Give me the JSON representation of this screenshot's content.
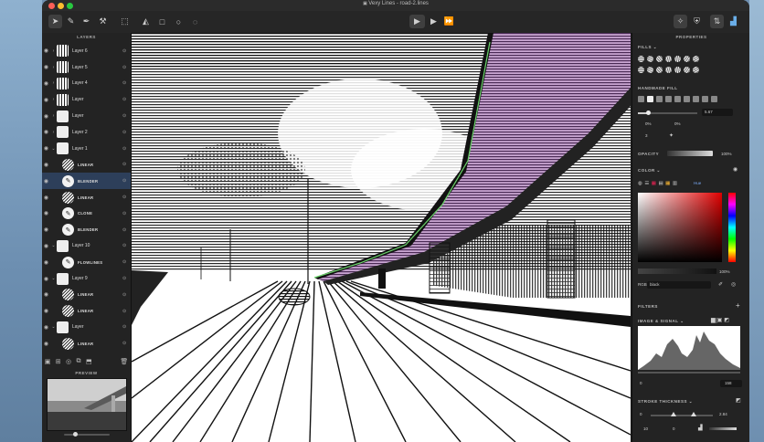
{
  "window": {
    "title": "Vexy Lines - road-2.lines",
    "title_icon": "document-icon"
  },
  "toolbar": {
    "left_tools": [
      "pointer-icon",
      "pen-icon",
      "bezier-pen-icon",
      "brush-icon",
      "transform-icon",
      "fill-bucket-icon",
      "rectangle-icon",
      "ellipse-icon",
      "lasso-icon"
    ],
    "center": [
      "run-icon",
      "play-icon",
      "fast-forward-icon"
    ],
    "right_tools": [
      "magic-wand-icon",
      "shield-icon",
      "properties-icon",
      "chart-icon"
    ]
  },
  "layers_panel": {
    "header": "LAYERS",
    "items": [
      {
        "name": "Layer 6",
        "type": "group",
        "thumb": "img",
        "expanded": false
      },
      {
        "name": "Layer 5",
        "type": "group",
        "thumb": "img",
        "expanded": false
      },
      {
        "name": "Layer 4",
        "type": "group",
        "thumb": "img",
        "expanded": false
      },
      {
        "name": "Layer",
        "type": "group",
        "thumb": "img",
        "expanded": false
      },
      {
        "name": "Layer",
        "type": "group",
        "thumb": "plain",
        "expanded": false
      },
      {
        "name": "Layer 2",
        "type": "group",
        "thumb": "plain",
        "expanded": false
      },
      {
        "name": "Layer 1",
        "type": "group",
        "thumb": "plain",
        "expanded": true
      },
      {
        "name": "LINEAR",
        "type": "fill",
        "thumb": "circ"
      },
      {
        "name": "BLENDER",
        "type": "fill",
        "thumb": "icon",
        "selected": true
      },
      {
        "name": "LINEAR",
        "type": "fill",
        "thumb": "circ"
      },
      {
        "name": "CLONE",
        "type": "fill",
        "thumb": "icon"
      },
      {
        "name": "BLENDER",
        "type": "fill",
        "thumb": "icon"
      },
      {
        "name": "Layer 10",
        "type": "group",
        "thumb": "plain",
        "expanded": true
      },
      {
        "name": "FLOWLINES",
        "type": "fill",
        "thumb": "icon"
      },
      {
        "name": "Layer 9",
        "type": "group",
        "thumb": "plain",
        "expanded": true
      },
      {
        "name": "LINEAR",
        "type": "fill",
        "thumb": "circ"
      },
      {
        "name": "LINEAR",
        "type": "fill",
        "thumb": "circ"
      },
      {
        "name": "Layer",
        "type": "group",
        "thumb": "plain",
        "expanded": true
      },
      {
        "name": "LINEAR",
        "type": "fill",
        "thumb": "circ"
      }
    ],
    "footer_icons": [
      "image-icon",
      "add-layer-icon",
      "add-fill-icon",
      "duplicate-icon",
      "group-icon",
      "trash-icon"
    ],
    "preview_header": "PREVIEW"
  },
  "properties": {
    "header": "PROPERTIES",
    "fills_label": "FILLS",
    "handmade_fill": "HANDMADE FILL",
    "slider_value": "5.67",
    "param1": "0%",
    "param2": "0%",
    "param3": "3",
    "opacity_label": "OPACITY",
    "opacity_value": "100%",
    "color_label": "COLOR",
    "hue_label": "Hue",
    "alpha_value": "100%",
    "rgb_label": "RGB",
    "rgb_value": "black",
    "filters_label": "FILTERS",
    "image_signal_label": "IMAGE & SIGNAL",
    "histogram_min": "0",
    "histogram_max": "158",
    "stroke_thickness_label": "STROKE THICKNESS",
    "stroke_min": "0",
    "stroke_max": "2.84",
    "stroke_a": "10",
    "stroke_b": "0"
  },
  "colors": {
    "accent": "#3b7cf4",
    "selected_row": "#2d3f5a",
    "highlight": "#a15cb8"
  }
}
